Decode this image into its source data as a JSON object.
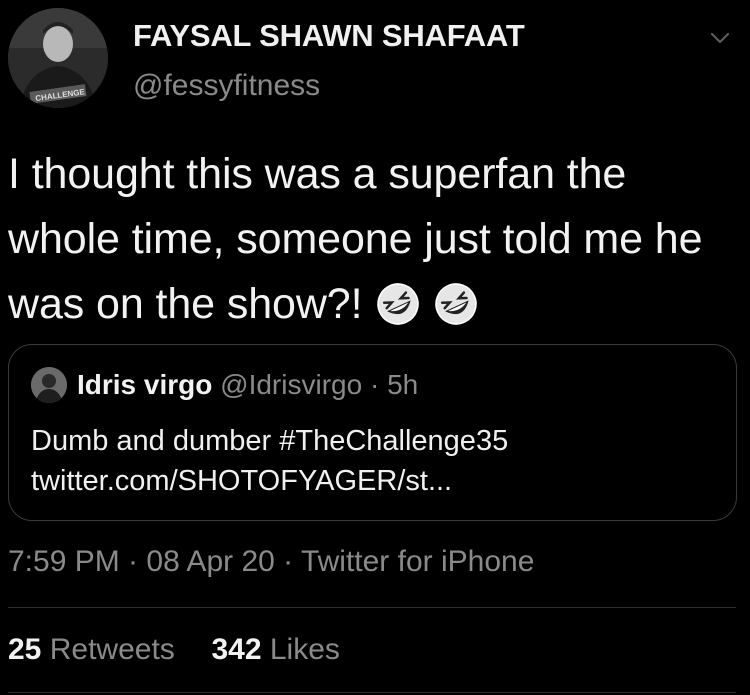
{
  "author": {
    "name": "FAYSAL SHAWN SHAFAAT",
    "handle": "@fessyfitness",
    "avatar_badge": "CHALLENGE"
  },
  "tweet": {
    "text": "I thought this was a superfan the whole time, someone just told me he was on the show?!",
    "emojis": [
      "rolling-on-floor-laughing",
      "rolling-on-floor-laughing"
    ]
  },
  "quoted_tweet": {
    "name": "Idris virgo",
    "handle": "@Idrisvirgo",
    "separator": "·",
    "time": "5h",
    "line1": "Dumb and dumber #TheChallenge35",
    "line2": "twitter.com/SHOTOFYAGER/st..."
  },
  "meta": {
    "text": "7:59 PM · 08 Apr 20 · Twitter for iPhone"
  },
  "stats": {
    "retweets_count": "25",
    "retweets_label": "Retweets",
    "likes_count": "342",
    "likes_label": "Likes"
  },
  "colors": {
    "background": "#000000",
    "primary_text": "#f2f2f2",
    "secondary_text": "#8a8a8a",
    "border": "#3b3b3b"
  }
}
